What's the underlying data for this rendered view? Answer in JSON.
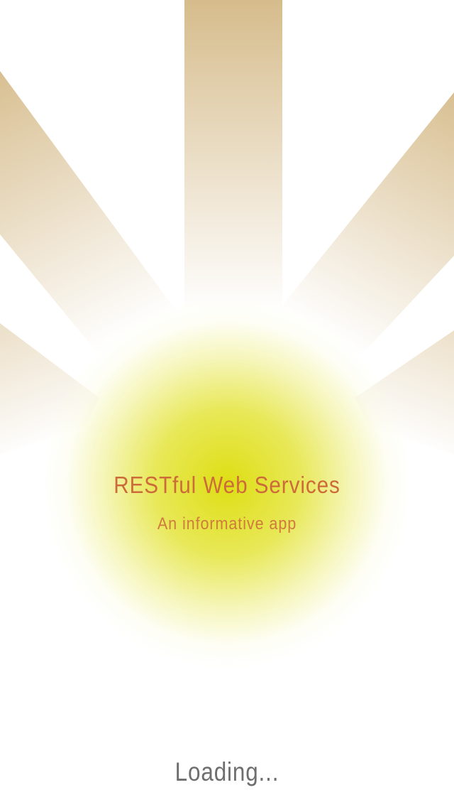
{
  "splash": {
    "title": "RESTful Web Services",
    "subtitle": "An informative app",
    "loading_label": "Loading..."
  },
  "colors": {
    "background": "#ffffff",
    "ray": "#d6bc8c",
    "glow_core": "#dede14",
    "title": "#cc6a3a",
    "subtitle": "#d07a3e",
    "loading": "#6e6e6e"
  }
}
